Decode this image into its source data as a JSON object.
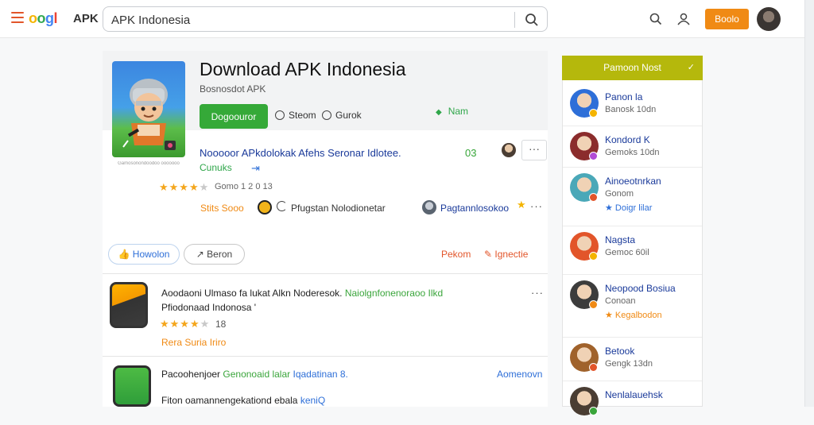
{
  "header": {
    "logo_parts": [
      "o",
      "o",
      "g",
      "l"
    ],
    "logo_apk": "APK",
    "search_value": "APK Indonesia",
    "button_label": "Boolo",
    "icons": [
      "menu-icon",
      "search-icon",
      "user-icon",
      "avatar"
    ]
  },
  "app": {
    "title": "Download APK Indonesia",
    "subtitle": "Bosnosdot APK",
    "download_label": "Dogoouror",
    "pill_1": "Steom",
    "pill_2": "Gurok",
    "more_link": "Nam",
    "description": "Nooooor APkdolokak Afehs Seronar Idlotee.",
    "count": "03",
    "more_dots": "···",
    "category_link": "Cunuks",
    "rating_stars": 4,
    "rating_text": "Gomo 1 2 0 13",
    "tag_orange": "Stits Sooo",
    "tag_dev": "Pfugstan Nolodionetar",
    "developer_name": "Pagtannlosokoo",
    "like_label": "Howolon",
    "share_label": "Beron",
    "report_label": "Pekom",
    "tag_label": "Ignectie",
    "icon_caption": "Gamosonondoodoo ooooooo"
  },
  "list": [
    {
      "text_black": "Aoodaoni Ulmaso fa lukat Alkn Noderesok.",
      "text_green": "Naiolgnfonenoraoo Ilkd",
      "text_line2": "Pfiodonaad Indonosa '",
      "stars": 4,
      "count": "18",
      "tag": "Rera Suria Iriro",
      "more": "···"
    },
    {
      "text_black": "Pacoohenjoer",
      "text_green": "Genonoaid lalar",
      "text_blue": "Iqadatinan 8.",
      "text_line2": "Fiton oamannengekationd ebala",
      "text_line2_blue": "keniQ",
      "more": "Aomenovn"
    }
  ],
  "sidebar": {
    "header": "Pamoon Nost",
    "items": [
      {
        "name": "Panon la",
        "meta": "Banosk 10dn",
        "extra": "",
        "color": "#2e6fd8",
        "badge": "#f4b400"
      },
      {
        "name": "Kondord K",
        "meta": "Gemoks 10dn",
        "extra": "",
        "color": "#8b2c2c",
        "badge": "#b24bd6"
      },
      {
        "name": "Ainoeotnrkan",
        "meta": "Gonom",
        "extra": "Doigr lilar",
        "color": "#4aa8b8",
        "badge": "#e2552a"
      },
      {
        "name": "Nagsta",
        "meta": "Gemoc 60il",
        "extra": "",
        "color": "#e2552a",
        "badge": "#f4b400"
      },
      {
        "name": "Neopood Bosiua",
        "meta": "Conoan",
        "extra": "Kegalbodon",
        "color": "#3c3c3c",
        "badge": "#f08a14"
      },
      {
        "name": "Betook",
        "meta": "Gengk 13dn",
        "extra": "",
        "color": "#a0622b",
        "badge": "#e2552a"
      },
      {
        "name": "Nenlalauehsk",
        "meta": "",
        "extra": "",
        "color": "#4a3d33",
        "badge": "#3aa53b"
      }
    ]
  },
  "colors": {
    "accent_orange": "#f08a14",
    "download_green": "#35a938",
    "sidebar_header": "#b5b80c",
    "link_blue": "#1a3a9a"
  }
}
